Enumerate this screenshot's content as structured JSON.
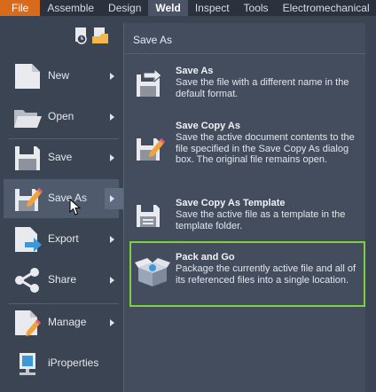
{
  "ribbon": {
    "tabs": [
      {
        "label": "File"
      },
      {
        "label": "Assemble"
      },
      {
        "label": "Design"
      },
      {
        "label": "Weld"
      },
      {
        "label": "Inspect"
      },
      {
        "label": "Tools"
      },
      {
        "label": "Electromechanical"
      }
    ],
    "active_tab": "Weld"
  },
  "app_menu": {
    "items": [
      {
        "label": "New",
        "icon": "new-document-icon",
        "has_submenu": true
      },
      {
        "label": "Open",
        "icon": "folder-open-icon",
        "has_submenu": true
      },
      {
        "label": "Save",
        "icon": "floppy-disk-icon",
        "has_submenu": true
      },
      {
        "label": "Save As",
        "icon": "save-as-pencil-icon",
        "has_submenu": true,
        "hovered": true
      },
      {
        "label": "Export",
        "icon": "export-icon",
        "has_submenu": true
      },
      {
        "label": "Share",
        "icon": "share-icon",
        "has_submenu": true
      },
      {
        "label": "Manage",
        "icon": "manage-icon",
        "has_submenu": true
      },
      {
        "label": "iProperties",
        "icon": "iproperties-icon",
        "has_submenu": false
      }
    ]
  },
  "submenu": {
    "title": "Save As",
    "entries": [
      {
        "title": "Save As",
        "desc": "Save the file with a different name in the default format.",
        "icon": "save-as-icon"
      },
      {
        "title": "Save Copy As",
        "desc": "Save the active document contents to the file specified in the Save Copy As dialog box. The original file remains open.",
        "icon": "save-copy-as-icon"
      },
      {
        "title": "Save Copy As Template",
        "desc": "Save the active file as a template in the template folder.",
        "icon": "save-template-icon"
      },
      {
        "title": "Pack and Go",
        "desc": "Package the currently active file and all of its referenced files into a single location.",
        "icon": "pack-and-go-icon",
        "highlighted": true
      }
    ]
  },
  "colors": {
    "file_tab": "#d86a1c",
    "background": "#3b4453",
    "panel": "#434d5e",
    "highlight_border": "#7fd13b"
  }
}
